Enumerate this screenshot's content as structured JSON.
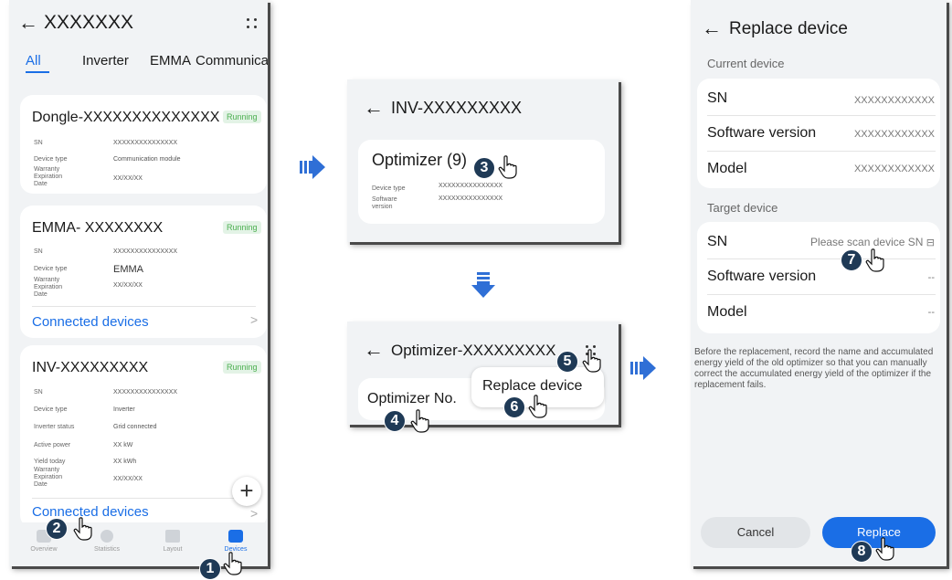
{
  "screen1": {
    "title": "XXXXXXX",
    "tabs": [
      "All",
      "Inverter",
      "EMMA",
      "Communicati"
    ],
    "dongle": {
      "name": "Dongle-XXXXXXXXXXXXXX",
      "status": "Running",
      "sn_label": "SN",
      "sn": "XXXXXXXXXXXXXXX",
      "type_label": "Device type",
      "type": "Communication module",
      "warranty_label": "Warranty Expiration Date",
      "warranty": "XX/XX/XX"
    },
    "emma": {
      "name": "EMMA- XXXXXXXX",
      "status": "Running",
      "sn_label": "SN",
      "sn": "XXXXXXXXXXXXXXX",
      "type_label": "Device type",
      "type": "EMMA",
      "warranty_label": "Warranty Expiration Date",
      "warranty": "XX/XX/XX",
      "connected": "Connected devices"
    },
    "inv": {
      "name": "INV-XXXXXXXXX",
      "status": "Running",
      "sn_label": "SN",
      "sn": "XXXXXXXXXXXXXXX",
      "type_label": "Device type",
      "type": "Inverter",
      "inv_status_label": "Inverter status",
      "inv_status": "Grid connected",
      "power_label": "Active power",
      "power": "XX kW",
      "yield_label": "Yield today",
      "yield": "XX kWh",
      "warranty_label": "Warranty Expiration Date",
      "warranty": "XX/XX/XX",
      "connected": "Connected devices"
    },
    "nav": [
      "Overview",
      "Statistics",
      "Layout",
      "Devices"
    ]
  },
  "screen2": {
    "title": "INV-XXXXXXXXX",
    "card_title": "Optimizer (9)",
    "type_label": "Device type",
    "type": "XXXXXXXXXXXXXXX",
    "sw_label": "Software version",
    "sw": "XXXXXXXXXXXXXXX"
  },
  "screen3": {
    "title": "Optimizer-XXXXXXXXX",
    "label": "Optimizer No.",
    "menu_item": "Replace device"
  },
  "screen4": {
    "title": "Replace device",
    "current_section": "Current device",
    "target_section": "Target device",
    "sn_label": "SN",
    "sn_current": "XXXXXXXXXXXX",
    "sw_label": "Software version",
    "sw_current": "XXXXXXXXXXXX",
    "model_label": "Model",
    "model_current": "XXXXXXXXXXXX",
    "sn_target": "Please scan device SN",
    "sw_target": "--",
    "model_target": "--",
    "note": "Before the replacement, record the name and accumulated energy yield of the old optimizer so that you can manually correct the accumulated energy yield of the optimizer if the replacement fails.",
    "cancel": "Cancel",
    "replace": "Replace"
  },
  "steps": [
    "1",
    "2",
    "3",
    "4",
    "5",
    "6",
    "7",
    "8"
  ],
  "colors": {
    "accent": "#1a6ee6",
    "step_bg": "#1f3a56",
    "arrow": "#2f6fd6",
    "running_bg": "#e3f3e6",
    "running_fg": "#4caf50"
  }
}
